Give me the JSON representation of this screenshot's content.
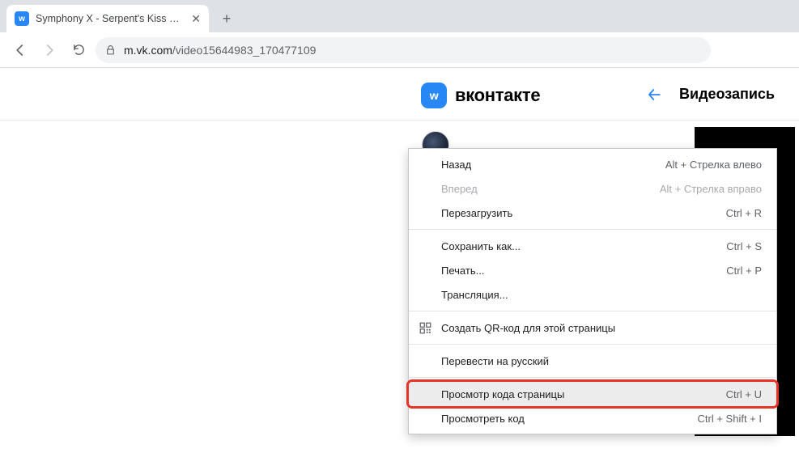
{
  "browser": {
    "tab_title": "Symphony X - Serpent's Kiss — В",
    "favicon_text": "w",
    "url_host": "m.vk.com",
    "url_path": "/video15644983_170477109"
  },
  "page": {
    "brand_logo_text": "w",
    "brand_word": "вконтакте",
    "section_title": "Видеозапись"
  },
  "context_menu": {
    "items": [
      {
        "label": "Назад",
        "shortcut": "Alt + Стрелка влево",
        "disabled": false
      },
      {
        "label": "Вперед",
        "shortcut": "Alt + Стрелка вправо",
        "disabled": true
      },
      {
        "label": "Перезагрузить",
        "shortcut": "Ctrl + R",
        "disabled": false
      }
    ],
    "items2": [
      {
        "label": "Сохранить как...",
        "shortcut": "Ctrl + S"
      },
      {
        "label": "Печать...",
        "shortcut": "Ctrl + P"
      },
      {
        "label": "Трансляция...",
        "shortcut": ""
      }
    ],
    "qr": {
      "label": "Создать QR-код для этой страницы"
    },
    "translate": {
      "label": "Перевести на русский"
    },
    "view_source": {
      "label": "Просмотр кода страницы",
      "shortcut": "Ctrl + U"
    },
    "inspect": {
      "label": "Просмотреть код",
      "shortcut": "Ctrl + Shift + I"
    }
  }
}
